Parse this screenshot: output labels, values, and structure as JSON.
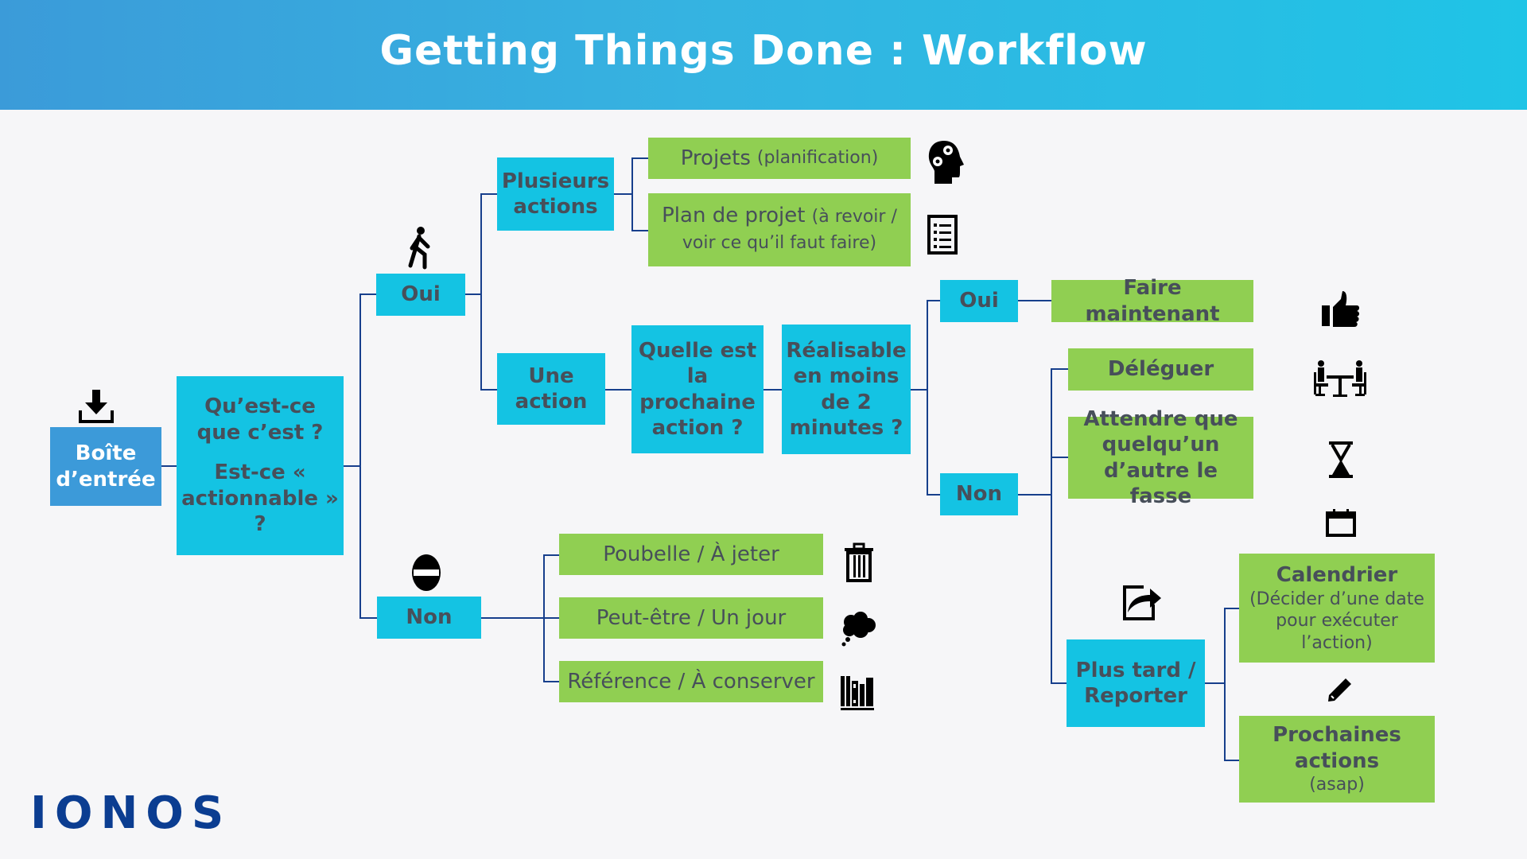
{
  "header": {
    "title": "Getting Things Done : Workflow"
  },
  "nodes": {
    "inbox": "Boîte d’entrée",
    "question1": "Qu’est-ce que c’est ?",
    "question2": "Est-ce « actionnable » ?",
    "yes1": "Oui",
    "no1": "Non",
    "multiple_actions": "Plusieurs actions",
    "one_action": "Une action",
    "projects_main": "Projets",
    "projects_sub": "(planification)",
    "project_plan_main": "Plan de projet",
    "project_plan_sub": "(à revoir / voir ce qu’il faut faire)",
    "next_action_q": "Quelle est la prochaine action ?",
    "two_minutes_q": "Réalisable en moins de 2 minutes ?",
    "yes2": "Oui",
    "no2": "Non",
    "do_now": "Faire maintenant",
    "delegate": "Déléguer",
    "wait": "Attendre que quelqu’un d’autre le fasse",
    "later": "Plus tard / Reporter",
    "calendar_main": "Calendrier",
    "calendar_sub": "(Décider d’une date pour exécuter l’action)",
    "next_actions_main": "Prochaines actions",
    "next_actions_sub": "(asap)",
    "trash": "Poubelle / À jeter",
    "someday": "Peut-être / Un jour",
    "reference": "Référence / À conserver"
  },
  "icons": {
    "inbox": "download-tray-icon",
    "yes1": "walking-person-icon",
    "no1": "no-entry-icon",
    "projects": "head-gears-icon",
    "project_plan": "checklist-icon",
    "do_now": "thumbs-up-icon",
    "delegate": "meeting-people-icon",
    "wait": "hourglass-icon",
    "calendar_top": "calendar-icon",
    "later": "share-forward-icon",
    "next_actions": "pencil-icon",
    "trash": "trash-icon",
    "someday": "thought-cloud-icon",
    "reference": "books-icon"
  },
  "colors": {
    "header_start": "#3b9bd9",
    "header_end": "#1fc4e6",
    "question_box": "#14c3e3",
    "inbox_box": "#3c9ad9",
    "outcome_box": "#90cf52",
    "connector": "#173f8c",
    "text": "#474f5a",
    "logo": "#0b3d91"
  },
  "logo": "IONOS"
}
